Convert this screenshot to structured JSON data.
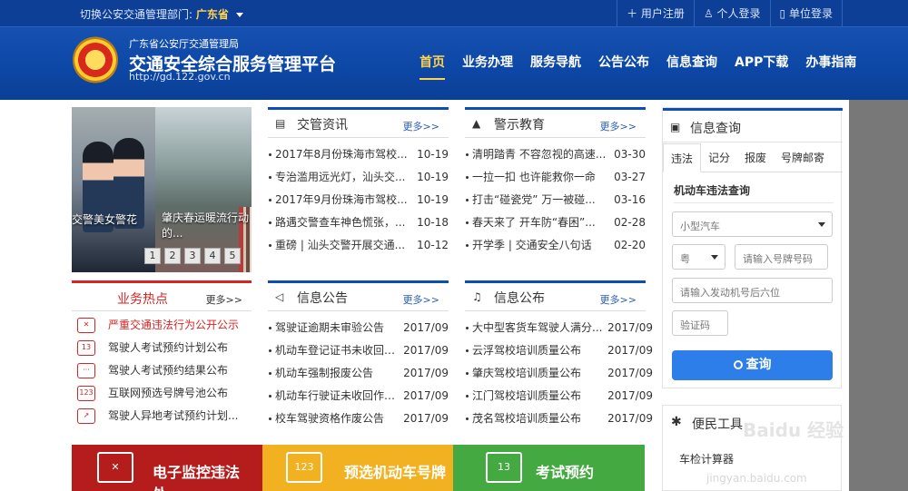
{
  "topbar": {
    "dept_label": "切换公安交通管理部门:",
    "dept_value": "广东省",
    "links": [
      "用户注册",
      "个人登录",
      "单位登录"
    ]
  },
  "header": {
    "agency": "广东省公安厅交通管理局",
    "title": "交通安全综合服务管理平台",
    "url": "http://gd.122.gov.cn"
  },
  "nav": {
    "items": [
      "首页",
      "业务办理",
      "服务导航",
      "公告公布",
      "信息查询",
      "APP下载",
      "办事指南"
    ]
  },
  "slider": {
    "captions": [
      "交警美女警花",
      "肇庆春运暖流行动的..."
    ],
    "pages": [
      "1",
      "2",
      "3",
      "4",
      "5"
    ]
  },
  "panels": {
    "news": {
      "title": "交管资讯",
      "more": "更多>>",
      "items": [
        {
          "text": "2017年8月份珠海市驾校...",
          "date": "10-19"
        },
        {
          "text": "专治滥用远光灯，汕头交...",
          "date": "10-19"
        },
        {
          "text": "2017年9月份珠海市驾校...",
          "date": "10-19"
        },
        {
          "text": "路遇交警查车神色慌张，...",
          "date": "10-18"
        },
        {
          "text": "重磅 | 汕头交警开展交通...",
          "date": "10-12"
        }
      ]
    },
    "warning": {
      "title": "警示教育",
      "more": "更多>>",
      "items": [
        {
          "text": "清明踏青 不容忽视的高速...",
          "date": "03-30"
        },
        {
          "text": "一拉一扣 也许能救你一命",
          "date": "03-27"
        },
        {
          "text": "打击“碰瓷党” 万一被碰...",
          "date": "03-16"
        },
        {
          "text": "春天来了 开车防“春困”...",
          "date": "02-28"
        },
        {
          "text": "开学季 | 交通安全八句话",
          "date": "02-20"
        }
      ]
    },
    "hot": {
      "title": "业务热点",
      "more": "更多>>",
      "items": [
        {
          "icon": "violation-icon",
          "text": "严重交通违法行为公开公示"
        },
        {
          "icon": "calendar-icon",
          "text": "驾驶人考试预约计划公布"
        },
        {
          "icon": "calendar-result-icon",
          "text": "驾驶人考试预约结果公布"
        },
        {
          "icon": "number-plate-icon",
          "text": "互联网预选号牌号池公布"
        },
        {
          "icon": "remote-exam-icon",
          "text": "驾驶人异地考试预约计划..."
        }
      ]
    },
    "notice": {
      "title": "信息公告",
      "more": "更多>>",
      "items": [
        {
          "text": "驾驶证逾期未审验公告",
          "date": "2017/09"
        },
        {
          "text": "机动车登记证书未收回作...",
          "date": "2017/09"
        },
        {
          "text": "机动车强制报废公告",
          "date": "2017/09"
        },
        {
          "text": "机动车行驶证未收回作废...",
          "date": "2017/09"
        },
        {
          "text": "校车驾驶资格作废公告",
          "date": "2017/09"
        }
      ]
    },
    "publish": {
      "title": "信息公布",
      "more": "更多>>",
      "items": [
        {
          "text": "大中型客货车驾驶人满分...",
          "date": "2017/09"
        },
        {
          "text": "云浮驾校培训质量公布",
          "date": "2017/09"
        },
        {
          "text": "肇庆驾校培训质量公布",
          "date": "2017/09"
        },
        {
          "text": "江门驾校培训质量公布",
          "date": "2017/09"
        },
        {
          "text": "茂名驾校培训质量公布",
          "date": "2017/09"
        }
      ]
    }
  },
  "query": {
    "title": "信息查询",
    "tabs": [
      "违法",
      "记分",
      "报废",
      "号牌邮寄"
    ],
    "subtitle": "机动车违法查询",
    "vehicle_type": "小型汽车",
    "province": "粤",
    "plate_placeholder": "请输入号牌号码",
    "engine_placeholder": "请输入发动机号后六位",
    "captcha_placeholder": "验证码",
    "button": "查询"
  },
  "tools": {
    "title": "便民工具",
    "items": [
      "车检计算器"
    ]
  },
  "watermark": {
    "brand": "Baidu 经验",
    "url": "jingyan.baidu.com"
  },
  "banners": [
    "电子监控违法处...",
    "预选机动车号牌",
    "考试预约"
  ],
  "colors": {
    "brand_blue": "#0d47a6",
    "accent_yellow": "#ffd34d",
    "hot_red": "#d82323",
    "query_button": "#2d7ee8",
    "banner_red": "#b51d1d",
    "banner_yellow": "#f1b120",
    "banner_green": "#43a940"
  }
}
